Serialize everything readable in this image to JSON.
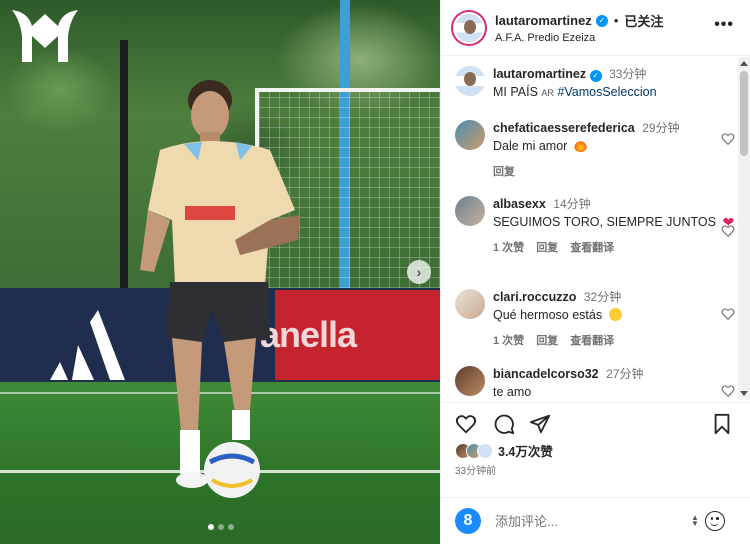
{
  "post": {
    "author": "lautaromartinez",
    "follow_status": "已关注",
    "separator": "•",
    "location": "A.F.A. Predio Ezeiza",
    "more_label": "•••"
  },
  "media": {
    "banner_text": "anella",
    "next_arrow": "›",
    "slide_count": 3,
    "active_slide": 0
  },
  "caption": {
    "user": "lautaromartinez",
    "time": "33分钟",
    "text_main": "MI PAÍS",
    "flag": "AR",
    "hashtag": "#VamosSeleccion"
  },
  "comments": [
    {
      "user": "chefaticaesserefederica",
      "time": "29分钟",
      "text": "Dale mi amor",
      "emoji": "fire-emoji",
      "likes": "",
      "reply_label": "回复",
      "translate_label": ""
    },
    {
      "user": "albasexx",
      "time": "14分钟",
      "text": "SEGUIMOS TORO, SIEMPRE JUNTOS",
      "emoji": "heart-emoji",
      "likes": "1 次赞",
      "reply_label": "回复",
      "translate_label": "查看翻译"
    },
    {
      "user": "clari.roccuzzo",
      "time": "32分钟",
      "text": "Qué hermoso estás",
      "emoji": "heart-eyes-emoji",
      "likes": "1 次赞",
      "reply_label": "回复",
      "translate_label": "查看翻译"
    },
    {
      "user": "biancadelcorso32",
      "time": "27分钟",
      "text": "te amo",
      "emoji": "",
      "likes": "",
      "reply_label": "",
      "translate_label": ""
    }
  ],
  "engagement": {
    "likes_text": "3.4万次赞",
    "posted_ago": "33分钟前"
  },
  "comment_box": {
    "avatar_letter": "8",
    "placeholder": "添加评论..."
  },
  "colors": {
    "verified": "#0095f6",
    "hashtag": "#00376b",
    "heart": "#e0245e"
  }
}
